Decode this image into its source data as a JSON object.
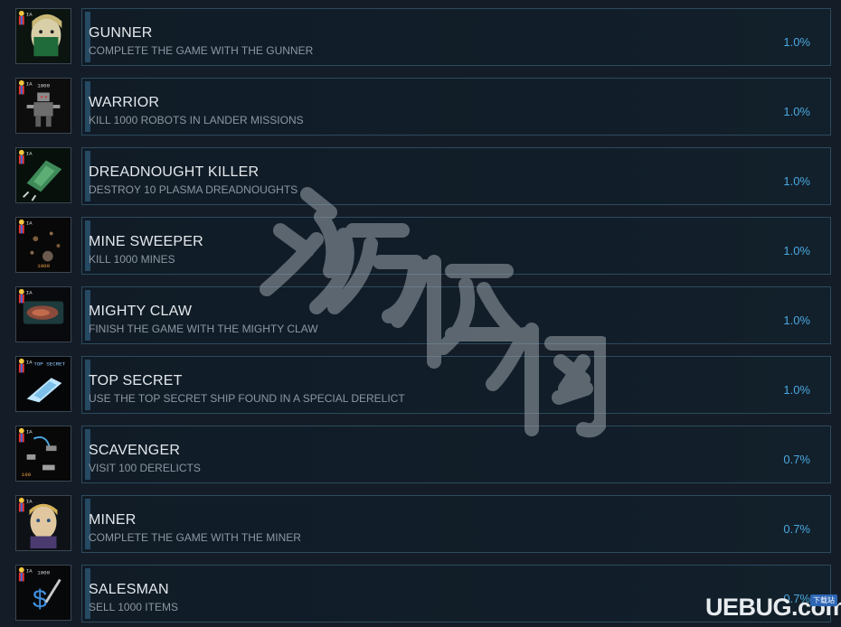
{
  "achievements": [
    {
      "name": "GUNNER",
      "description": "COMPLETE THE GAME WITH THE GUNNER",
      "percent": "1.0%",
      "icon": "gunner-portrait-icon"
    },
    {
      "name": "WARRIOR",
      "description": "KILL 1000 ROBOTS IN LANDER MISSIONS",
      "percent": "1.0%",
      "icon": "robot-icon",
      "badge": "1000"
    },
    {
      "name": "DREADNOUGHT KILLER",
      "description": "DESTROY 10 PLASMA DREADNOUGHTS",
      "percent": "1.0%",
      "icon": "dreadnought-ship-icon"
    },
    {
      "name": "MINE SWEEPER",
      "description": "KILL 1000 MINES",
      "percent": "1.0%",
      "icon": "mines-icon",
      "badge": "1000"
    },
    {
      "name": "MIGHTY CLAW",
      "description": "FINISH THE GAME WITH THE MIGHTY CLAW",
      "percent": "1.0%",
      "icon": "claw-ship-icon"
    },
    {
      "name": "TOP SECRET",
      "description": "USE THE TOP SECRET SHIP FOUND IN A SPECIAL DERELICT",
      "percent": "1.0%",
      "icon": "secret-ship-icon",
      "badge": "TOP SECRET"
    },
    {
      "name": "SCAVENGER",
      "description": "VISIT 100 DERELICTS",
      "percent": "0.7%",
      "icon": "derelicts-icon",
      "badge": "100"
    },
    {
      "name": "MINER",
      "description": "COMPLETE THE GAME WITH THE MINER",
      "percent": "0.7%",
      "icon": "miner-portrait-icon"
    },
    {
      "name": "SALESMAN",
      "description": "SELL 1000 ITEMS",
      "percent": "0.7%",
      "icon": "dollar-sword-icon",
      "badge": "1000"
    }
  ],
  "watermark": {
    "text": "游侠网"
  },
  "logo": {
    "text": "UEBUG.com",
    "tag": "下载站"
  },
  "colors": {
    "accent": "#4aa8e0",
    "panel_border": "#2d4a5e",
    "background": "#141d27"
  }
}
